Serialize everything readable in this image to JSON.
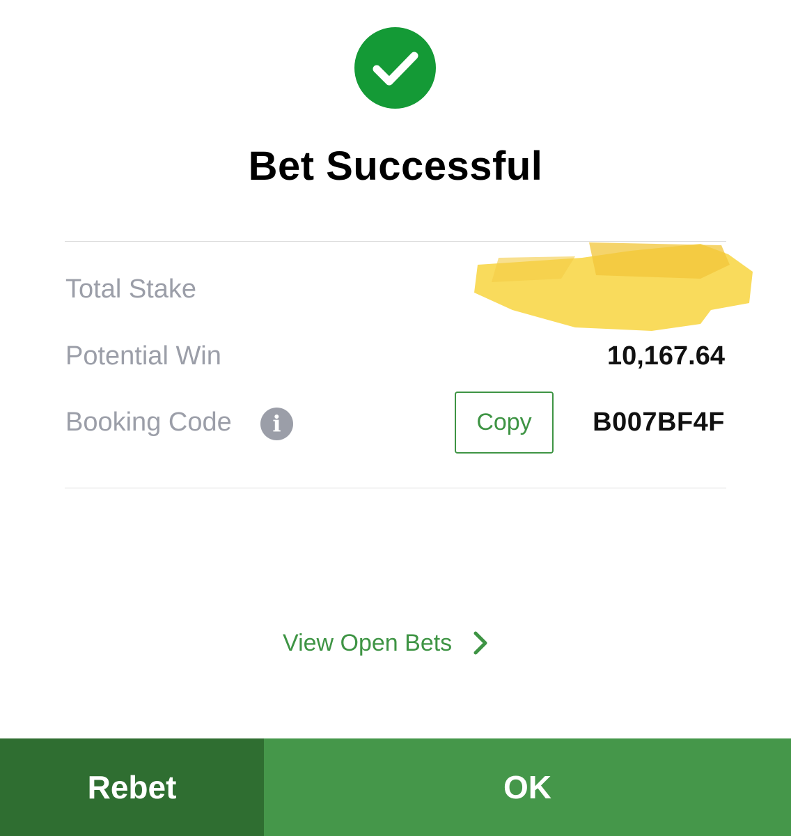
{
  "header": {
    "success_icon": "check-circle-icon",
    "title": "Bet Successful"
  },
  "summary": {
    "total_stake_label": "Total Stake",
    "potential_win_label": "Potential Win",
    "potential_win_value": "10,167.64",
    "booking_code_label": "Booking Code",
    "booking_code_info_icon": "info-icon",
    "booking_code_info_glyph": "i",
    "copy_label": "Copy",
    "booking_code_value": "B007BF4F"
  },
  "links": {
    "view_open_bets": "View Open Bets",
    "chevron_icon": "chevron-right-icon"
  },
  "footer": {
    "rebet_label": "Rebet",
    "ok_label": "OK"
  },
  "colors": {
    "success_green": "#149a36",
    "accent_green": "#3e9444",
    "rebet_bg": "#2f6e31",
    "ok_bg": "#45974a",
    "label_gray": "#9b9ea8",
    "redaction_yellow": "#f7d54a"
  }
}
